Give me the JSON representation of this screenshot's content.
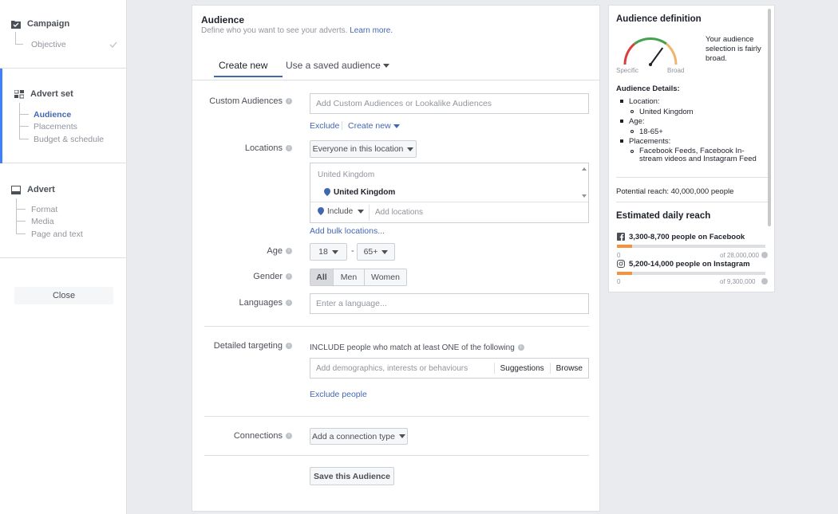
{
  "sidebar": {
    "campaign": {
      "label": "Campaign",
      "items": [
        {
          "label": "Objective"
        }
      ]
    },
    "advert_set": {
      "label": "Advert set",
      "items": [
        {
          "label": "Audience"
        },
        {
          "label": "Placements"
        },
        {
          "label": "Budget & schedule"
        }
      ]
    },
    "advert": {
      "label": "Advert",
      "items": [
        {
          "label": "Format"
        },
        {
          "label": "Media"
        },
        {
          "label": "Page and text"
        }
      ]
    },
    "close_label": "Close"
  },
  "audience": {
    "title": "Audience",
    "subtitle": "Define who you want to see your adverts.",
    "learn_more": "Learn more.",
    "tabs": [
      {
        "label": "Create new"
      },
      {
        "label": "Use a saved audience"
      }
    ],
    "custom_audiences": {
      "label": "Custom Audiences",
      "placeholder": "Add Custom Audiences or Lookalike Audiences",
      "exclude": "Exclude",
      "create_new": "Create new"
    },
    "locations": {
      "label": "Locations",
      "dropdown": "Everyone in this location",
      "group": "United Kingdom",
      "selected": "United Kingdom",
      "include": "Include",
      "placeholder": "Add locations",
      "bulk_link": "Add bulk locations..."
    },
    "age": {
      "label": "Age",
      "min": "18",
      "separator": "-",
      "max": "65+"
    },
    "gender": {
      "label": "Gender",
      "options": [
        {
          "label": "All"
        },
        {
          "label": "Men"
        },
        {
          "label": "Women"
        }
      ]
    },
    "languages": {
      "label": "Languages",
      "placeholder": "Enter a language..."
    },
    "detailed": {
      "label": "Detailed targeting",
      "include_text": "INCLUDE people who match at least ONE of the following",
      "placeholder": "Add demographics, interests or behaviours",
      "suggestions": "Suggestions",
      "browse": "Browse",
      "exclude_link": "Exclude people"
    },
    "connections": {
      "label": "Connections",
      "dropdown": "Add a connection type"
    },
    "save_label": "Save this Audience"
  },
  "definition": {
    "title": "Audience definition",
    "gauge_specific": "Specific",
    "gauge_broad": "Broad",
    "gauge_level": 0.7,
    "description": "Your audience selection is fairly broad.",
    "details_title": "Audience Details:",
    "location_label": "Location:",
    "location_value": "United Kingdom",
    "age_label": "Age:",
    "age_value": "18-65+",
    "placements_label": "Placements:",
    "placements_value": "Facebook Feeds, Facebook In-stream videos and Instagram Feed",
    "potential_reach": "Potential reach: 40,000,000 people",
    "daily_title": "Estimated daily reach",
    "facebook": {
      "text": "3,300-8,700 people on Facebook",
      "min": "0",
      "max": "of 28,000,000",
      "fill": 0.1
    },
    "instagram": {
      "text": "5,200-14,000 people on Instagram",
      "min": "0",
      "max": "of 9,300,000",
      "fill": 0.1
    },
    "colors": {
      "accent": "#4267b2",
      "bar_fill": "#f7923b"
    }
  }
}
